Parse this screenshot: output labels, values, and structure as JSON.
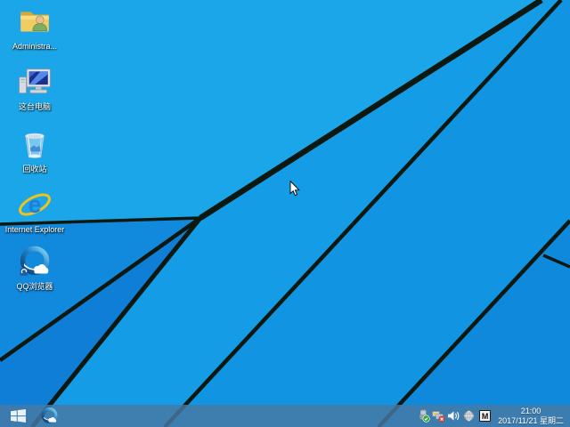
{
  "desktop": {
    "icons": [
      {
        "name": "administrator-folder",
        "label": "Administra..."
      },
      {
        "name": "this-pc",
        "label": "这台电脑"
      },
      {
        "name": "recycle-bin",
        "label": "回收站"
      },
      {
        "name": "internet-explorer",
        "label": "Internet Explorer"
      },
      {
        "name": "qq-browser",
        "label": "QQ浏览器"
      }
    ],
    "ie_glyph": "e"
  },
  "taskbar": {
    "pinned": [
      {
        "name": "qq-browser"
      }
    ],
    "tray": {
      "icons": [
        "safely-remove-hardware",
        "network-disconnected",
        "volume",
        "language-globe"
      ],
      "input_indicator": "M",
      "clock": {
        "time": "21:00",
        "date": "2017/11/21 星期二"
      }
    }
  },
  "colors": {
    "wallpaper_top": "#1ea9ea",
    "wallpaper_bottom": "#0e8ee0",
    "wallpaper_line": "#0c1810",
    "taskbar": "#3f7cb0",
    "label_text": "#ffffff"
  }
}
